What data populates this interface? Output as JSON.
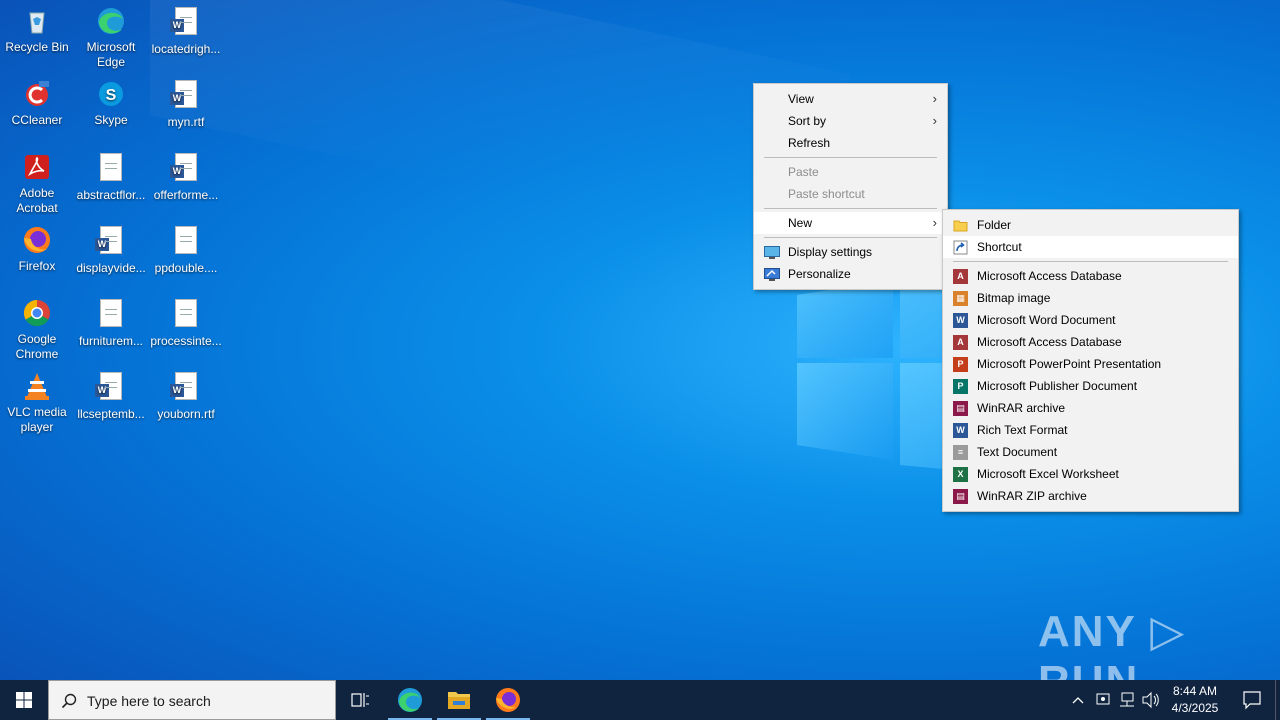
{
  "desktop": {
    "icons": [
      {
        "label": "Recycle Bin",
        "icon": "recycle-bin-icon"
      },
      {
        "label": "Microsoft Edge",
        "icon": "edge-icon"
      },
      {
        "label": "locatedrigh...",
        "icon": "word-doc-icon"
      },
      {
        "label": "CCleaner",
        "icon": "ccleaner-icon"
      },
      {
        "label": "Skype",
        "icon": "skype-icon"
      },
      {
        "label": "myn.rtf",
        "icon": "word-doc-icon"
      },
      {
        "label": "Adobe Acrobat",
        "icon": "acrobat-icon"
      },
      {
        "label": "abstractflor...",
        "icon": "text-doc-icon"
      },
      {
        "label": "offerforme...",
        "icon": "word-doc-icon"
      },
      {
        "label": "Firefox",
        "icon": "firefox-icon"
      },
      {
        "label": "displayvide...",
        "icon": "word-doc-icon"
      },
      {
        "label": "ppdouble....",
        "icon": "text-doc-icon"
      },
      {
        "label": "Google Chrome",
        "icon": "chrome-icon"
      },
      {
        "label": "furniturem...",
        "icon": "text-doc-icon"
      },
      {
        "label": "processinte...",
        "icon": "text-doc-icon"
      },
      {
        "label": "VLC media player",
        "icon": "vlc-icon"
      },
      {
        "label": "llcseptemb...",
        "icon": "word-doc-icon"
      },
      {
        "label": "youborn.rtf",
        "icon": "word-doc-icon"
      }
    ]
  },
  "context_menu": {
    "view": "View",
    "sort_by": "Sort by",
    "refresh": "Refresh",
    "paste": "Paste",
    "paste_shortcut": "Paste shortcut",
    "new": "New",
    "display_settings": "Display settings",
    "personalize": "Personalize"
  },
  "new_submenu": {
    "folder": "Folder",
    "shortcut": "Shortcut",
    "items": [
      {
        "label": "Microsoft Access Database",
        "icon": "access-icon",
        "color": "#a4373a",
        "glyph": "A"
      },
      {
        "label": "Bitmap image",
        "icon": "bitmap-icon",
        "color": "#d9822b",
        "glyph": "▦"
      },
      {
        "label": "Microsoft Word Document",
        "icon": "word-icon",
        "color": "#2b5797",
        "glyph": "W"
      },
      {
        "label": "Microsoft Access Database",
        "icon": "access-icon",
        "color": "#a4373a",
        "glyph": "A"
      },
      {
        "label": "Microsoft PowerPoint Presentation",
        "icon": "powerpoint-icon",
        "color": "#c43e1c",
        "glyph": "P"
      },
      {
        "label": "Microsoft Publisher Document",
        "icon": "publisher-icon",
        "color": "#077568",
        "glyph": "P"
      },
      {
        "label": "WinRAR archive",
        "icon": "winrar-icon",
        "color": "#8b1a4a",
        "glyph": "▤"
      },
      {
        "label": "Rich Text Format",
        "icon": "rtf-icon",
        "color": "#2b5797",
        "glyph": "W"
      },
      {
        "label": "Text Document",
        "icon": "text-doc-icon",
        "color": "#9a9a9a",
        "glyph": "≡"
      },
      {
        "label": "Microsoft Excel Worksheet",
        "icon": "excel-icon",
        "color": "#1e7145",
        "glyph": "X"
      },
      {
        "label": "WinRAR ZIP archive",
        "icon": "winrar-zip-icon",
        "color": "#8b1a4a",
        "glyph": "▤"
      }
    ]
  },
  "taskbar": {
    "search_placeholder": "Type here to search",
    "time": "8:44 AM",
    "date": "4/3/2025"
  },
  "watermark": "ANY ▷ RUN"
}
